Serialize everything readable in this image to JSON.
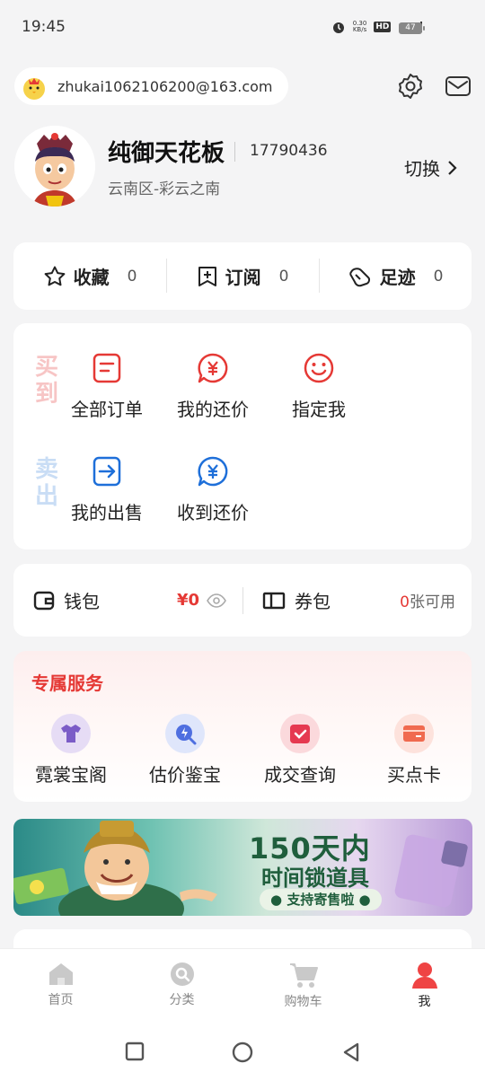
{
  "status_bar": {
    "time": "19:45",
    "net_speed": "0.30",
    "net_unit": "KB/s",
    "hd": "HD",
    "net_type": "5G",
    "battery": "47"
  },
  "account": {
    "email": "zhukai1062106200@163.com"
  },
  "profile": {
    "nickname": "纯御天花板",
    "uid": "17790436",
    "server": "云南区-彩云之南",
    "switch_label": "切换"
  },
  "stats": [
    {
      "label": "收藏",
      "count": "0",
      "icon": "star-icon"
    },
    {
      "label": "订阅",
      "count": "0",
      "icon": "bookmark-plus-icon"
    },
    {
      "label": "足迹",
      "count": "0",
      "icon": "footprint-icon"
    }
  ],
  "orders": {
    "buy_label": "买到",
    "sell_label": "卖出",
    "buy_items": [
      {
        "label": "全部订单",
        "icon": "order-list-icon"
      },
      {
        "label": "我的还价",
        "icon": "yen-chat-icon"
      },
      {
        "label": "指定我",
        "icon": "smiley-icon"
      }
    ],
    "sell_items": [
      {
        "label": "我的出售",
        "icon": "sell-arrow-icon"
      },
      {
        "label": "收到还价",
        "icon": "yen-chat-icon"
      }
    ]
  },
  "wallet": {
    "label": "钱包",
    "amount": "¥0",
    "coupon_label": "券包",
    "coupon_count": "0",
    "coupon_suffix": "张可用"
  },
  "services": {
    "title": "专属服务",
    "items": [
      {
        "label": "霓裳宝阁",
        "icon": "shirt-icon"
      },
      {
        "label": "估价鉴宝",
        "icon": "appraisal-icon"
      },
      {
        "label": "成交查询",
        "icon": "checkmark-box-icon"
      },
      {
        "label": "买点卡",
        "icon": "card-icon"
      }
    ]
  },
  "banner": {
    "title": "150天内",
    "subtitle": "时间锁道具",
    "tag": "支持寄售啦"
  },
  "tabs": [
    {
      "label": "首页",
      "icon": "home-icon"
    },
    {
      "label": "分类",
      "icon": "search-icon"
    },
    {
      "label": "购物车",
      "icon": "cart-icon"
    },
    {
      "label": "我",
      "icon": "person-icon",
      "active": true
    }
  ],
  "colors": {
    "accent_red": "#e53935",
    "accent_blue": "#1e6fd9",
    "background": "#f4f4f5"
  }
}
